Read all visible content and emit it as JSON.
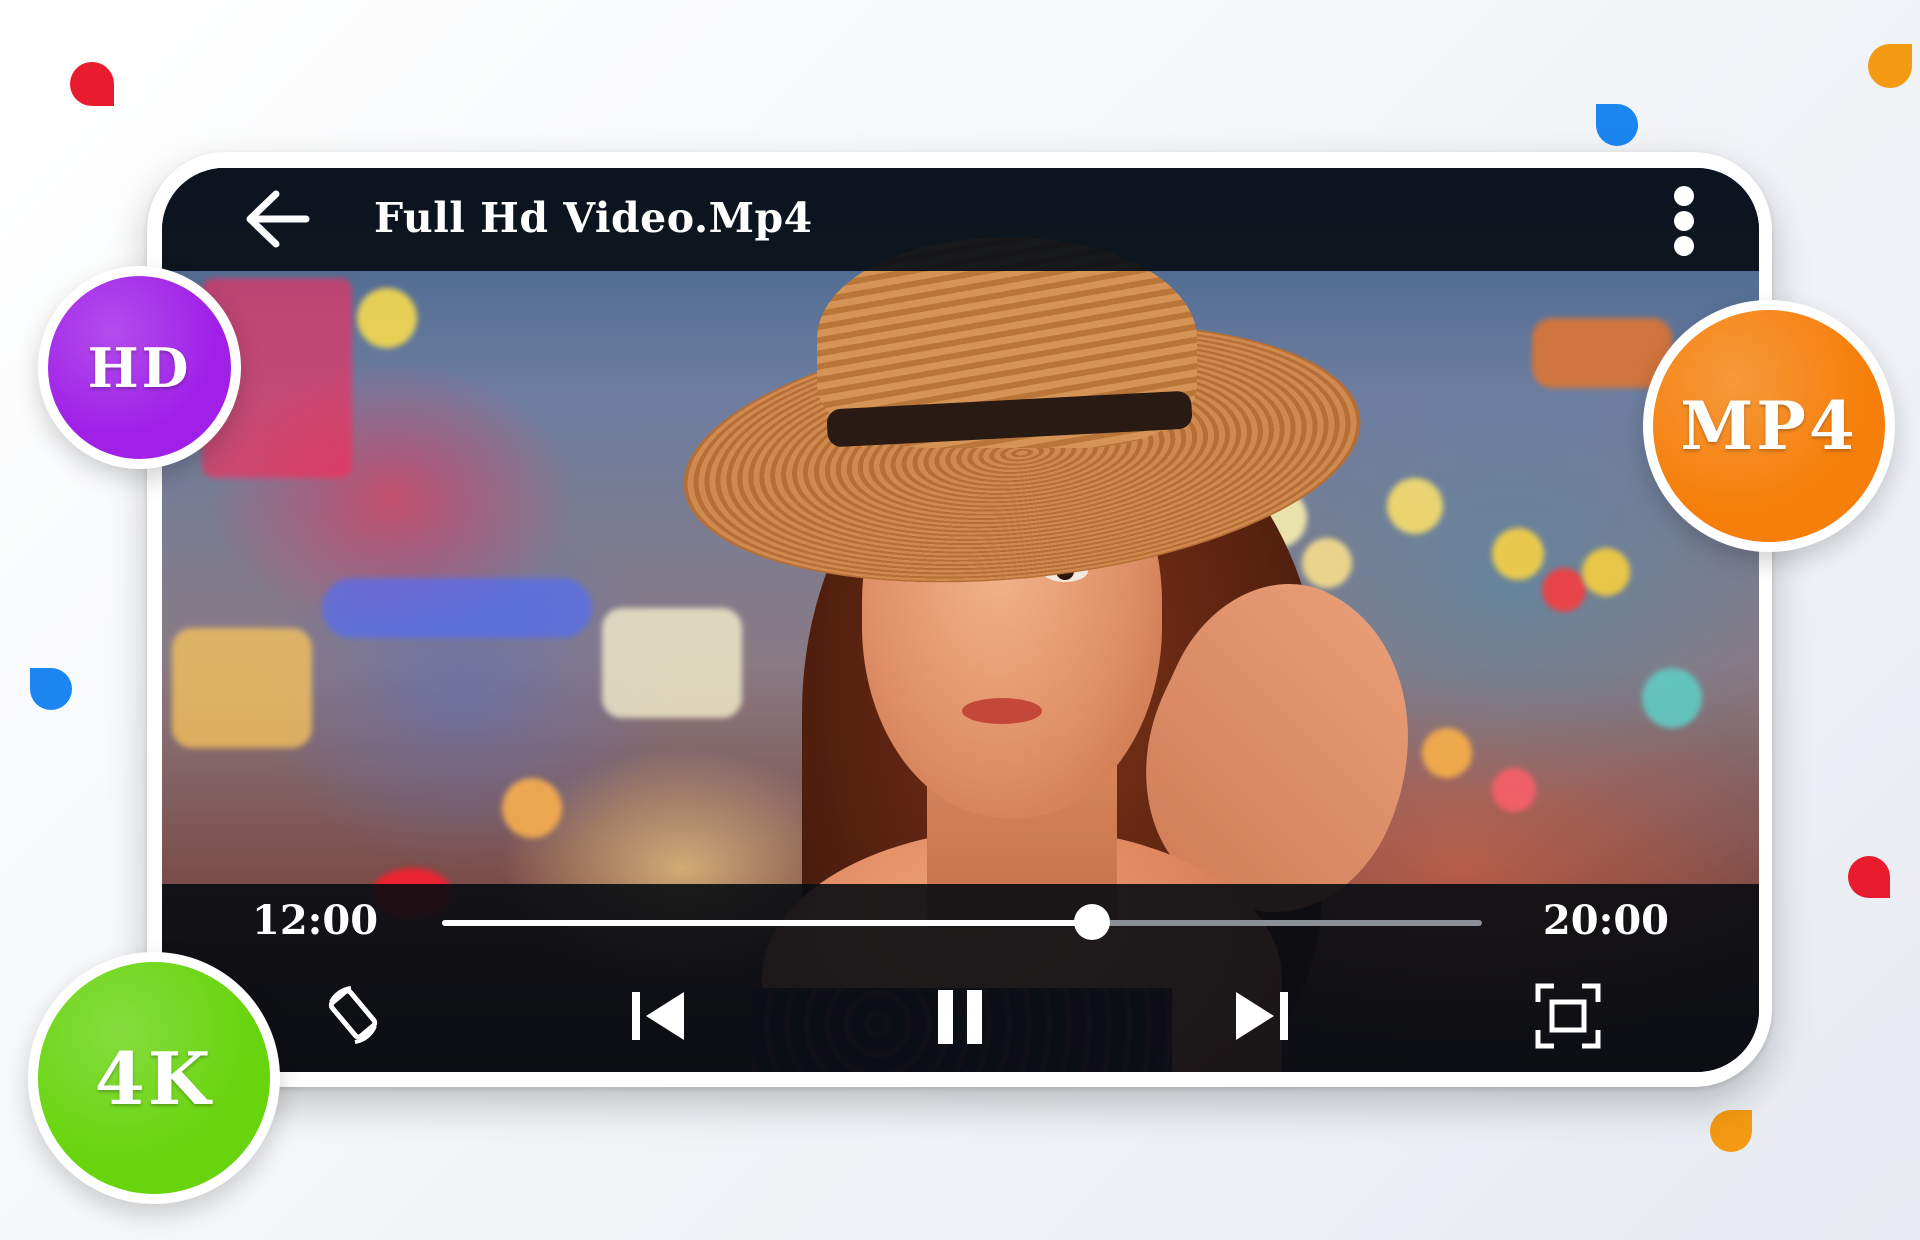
{
  "player": {
    "title": "Full Hd Video.Mp4",
    "current_time": "12:00",
    "total_time": "20:00",
    "progress": 0.625
  },
  "icons": {
    "back": "arrow-left-icon",
    "menu": "more-vertical-icon",
    "rotate": "screen-rotation-icon",
    "previous": "skip-previous-icon",
    "pause": "pause-icon",
    "next": "skip-next-icon",
    "fullscreen": "fullscreen-icon"
  },
  "badges": {
    "hd": "HD",
    "mp4": "MP4",
    "k4": "4K"
  },
  "colors": {
    "hd": "#a020e8",
    "mp4": "#f57f0a",
    "k4": "#68d40e",
    "confetti_red": "#e81c2c",
    "confetti_blue": "#1b86f2",
    "confetti_orange": "#f39a12"
  }
}
